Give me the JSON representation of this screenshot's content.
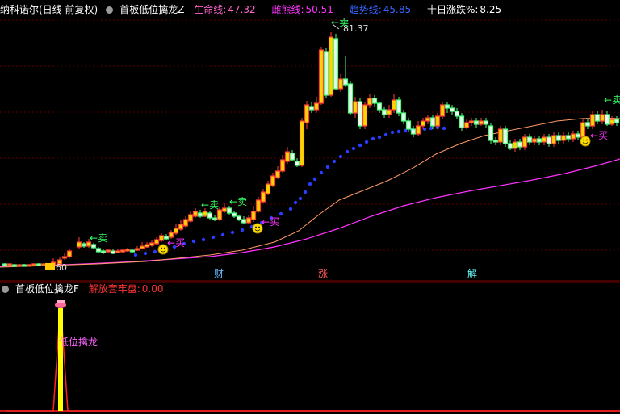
{
  "main_header": {
    "stock_title": "纳科诺尔(日线 前复权)",
    "indicator_name": "首板低位擒龙Z",
    "lines": [
      {
        "label": "生命线:",
        "value": "47.32",
        "color": "#ff66cc"
      },
      {
        "label": "雌熊线:",
        "value": "50.51",
        "color": "#ff33ff"
      },
      {
        "label": "趋势线:",
        "value": "45.85",
        "color": "#3366ff"
      },
      {
        "label": "十日涨跌%:",
        "value": "8.25",
        "color": "#ffffff"
      }
    ]
  },
  "sub_header": {
    "indicator_name": "首板低位擒龙F",
    "label": "解放套牢盘:",
    "value": "0.00",
    "color": "#ff3333"
  },
  "annotations": {
    "high_price": "81.37",
    "low_price": "60",
    "sell_label": "卖",
    "buy_label": "买",
    "arrow_left": "←",
    "sub_signal": "低位擒龙"
  },
  "markers": [
    {
      "text": "财",
      "color": "#66bbff"
    },
    {
      "text": "涨",
      "color": "#ff5555"
    },
    {
      "text": "解",
      "color": "#66ffff"
    }
  ],
  "colors": {
    "up": "#ff3b3b",
    "up_fill": "#ffd400",
    "down": "#49ff7a",
    "down_fill": "#e8ffee",
    "life_line": "#ff66cc",
    "bear_line": "#ff33ff",
    "trend_line": "#ff9966",
    "dots": "#2a3cff",
    "grid": "#7a0000"
  }
}
